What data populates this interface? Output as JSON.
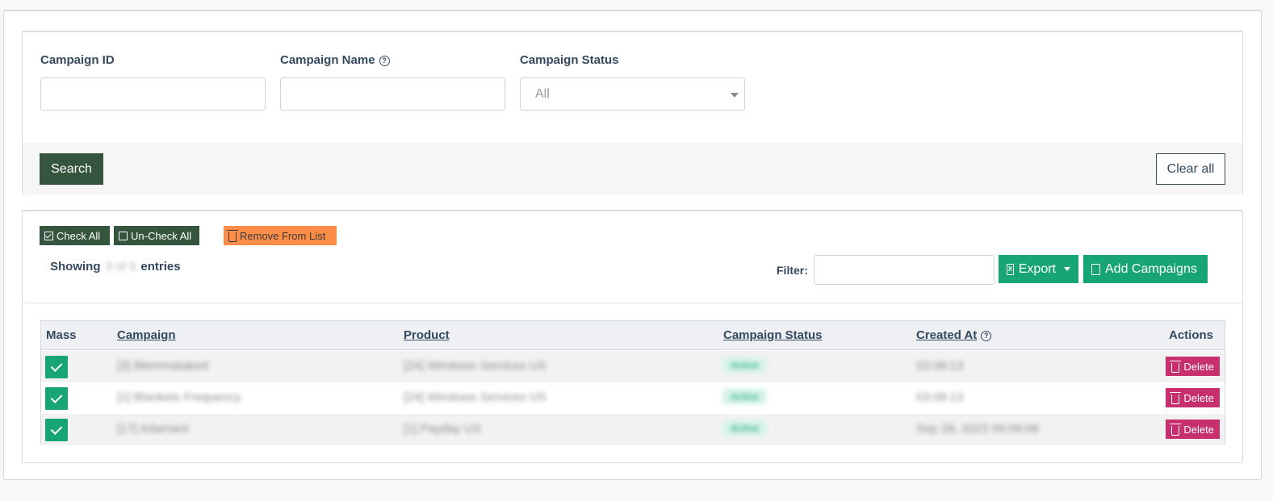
{
  "search_form": {
    "campaign_id": {
      "label": "Campaign ID",
      "value": "",
      "placeholder": ""
    },
    "campaign_name": {
      "label": "Campaign Name",
      "value": "",
      "placeholder": "",
      "help": "?"
    },
    "campaign_status": {
      "label": "Campaign Status",
      "selected": "All"
    },
    "search_label": "Search",
    "clear_label": "Clear all"
  },
  "list_toolbar": {
    "check_all": "Check All",
    "uncheck_all": "Un-Check All",
    "remove_from_list": "Remove From List",
    "showing_prefix": "Showing",
    "showing_count": "3 of 3",
    "showing_suffix": "entries",
    "filter_label": "Filter:",
    "filter_value": "",
    "export_label": "Export",
    "export_icon": "X",
    "add_label": "Add Campaigns"
  },
  "table": {
    "headers": {
      "mass": "Mass",
      "campaign": "Campaign",
      "product": "Product",
      "status": "Campaign Status",
      "created_at": "Created At",
      "created_help": "?",
      "actions": "Actions"
    },
    "rows": [
      {
        "campaign": "[3] Blemmataked",
        "product": "[24] Windows Services US",
        "status": "Active",
        "created": "03:08:13",
        "delete": "Delete"
      },
      {
        "campaign": "[1] Blankets Frequency",
        "product": "[24] Windows Services US",
        "status": "Active",
        "created": "03:08:13",
        "delete": "Delete"
      },
      {
        "campaign": "[17] Adamant",
        "product": "[1] Payday US",
        "status": "Active",
        "created": "Sep 28, 2023 09:09:08",
        "delete": "Delete"
      }
    ]
  },
  "colors": {
    "dark_green": "#35553f",
    "green": "#17a673",
    "orange": "#fd8d47",
    "delete": "#c72f6f",
    "text": "#34495e"
  }
}
